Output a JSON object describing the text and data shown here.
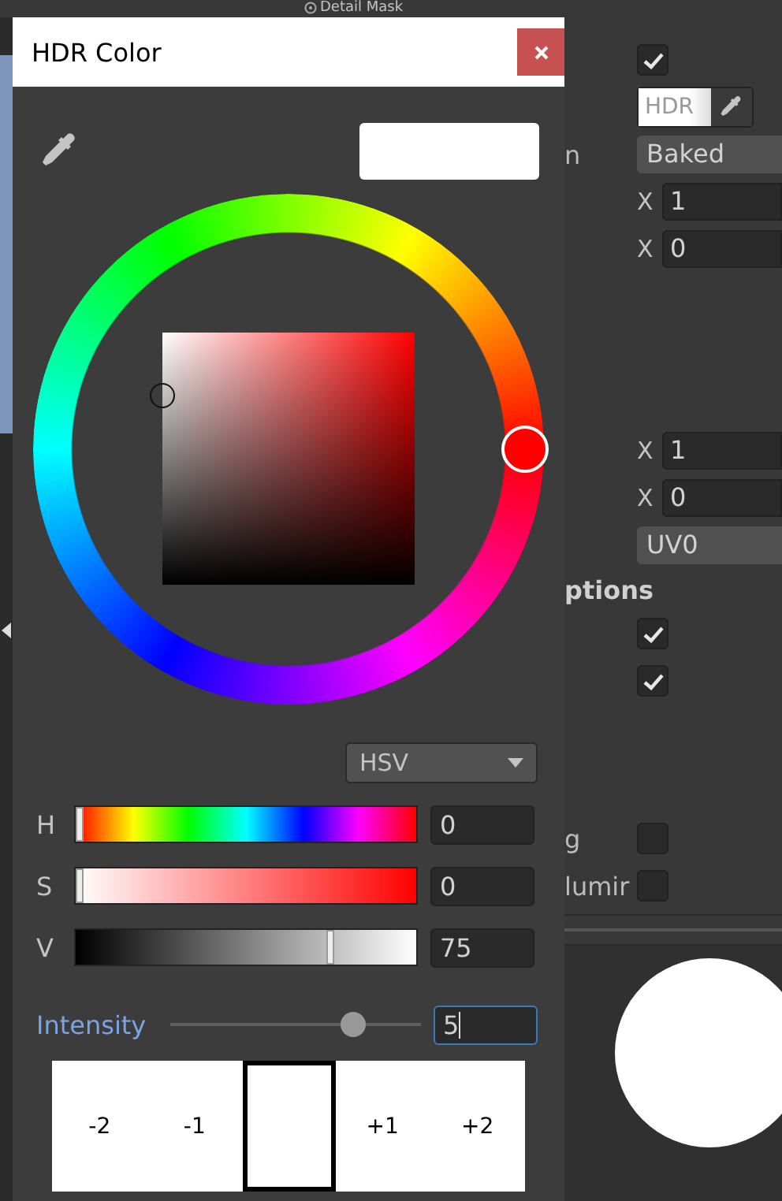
{
  "window": {
    "title": "HDR Color"
  },
  "mode_dropdown": {
    "value": "HSV"
  },
  "channels": [
    {
      "label": "H",
      "kind": "hue",
      "level": 0.0,
      "value": "0"
    },
    {
      "label": "S",
      "kind": "saturation",
      "level": 0.0,
      "value": "0"
    },
    {
      "label": "V",
      "kind": "value",
      "level": 0.75,
      "value": "75"
    }
  ],
  "intensity": {
    "label": "Intensity",
    "level": 0.73,
    "value": "5",
    "focused": true
  },
  "presets": [
    {
      "label": "-2",
      "selected": false
    },
    {
      "label": "-1",
      "selected": false
    },
    {
      "selected": true
    },
    {
      "label": "+1",
      "selected": false
    },
    {
      "label": "+2",
      "selected": false
    }
  ],
  "inspector": {
    "header": "Detail Mask",
    "groups": [
      [
        {
          "kind": "checkbox",
          "checked": true
        },
        {
          "kind": "hdr_color",
          "text": "HDR"
        },
        {
          "kind": "dropdown",
          "label": "n",
          "value": "Baked"
        },
        {
          "kind": "number",
          "label": "X",
          "value": "1"
        },
        {
          "kind": "number",
          "label": "X",
          "value": "0"
        }
      ],
      [
        {
          "kind": "number",
          "label": "X",
          "value": "1"
        },
        {
          "kind": "number",
          "label": "X",
          "value": "0"
        },
        {
          "kind": "dropdown",
          "value": "UV0"
        },
        {
          "kind": "section",
          "label": "ptions"
        },
        {
          "kind": "checkbox",
          "checked": true
        },
        {
          "kind": "checkbox",
          "checked": true
        }
      ],
      [
        {
          "kind": "checkbox",
          "label": "g",
          "checked": false
        },
        {
          "kind": "checkbox",
          "label": "lumir",
          "checked": false
        }
      ]
    ]
  }
}
